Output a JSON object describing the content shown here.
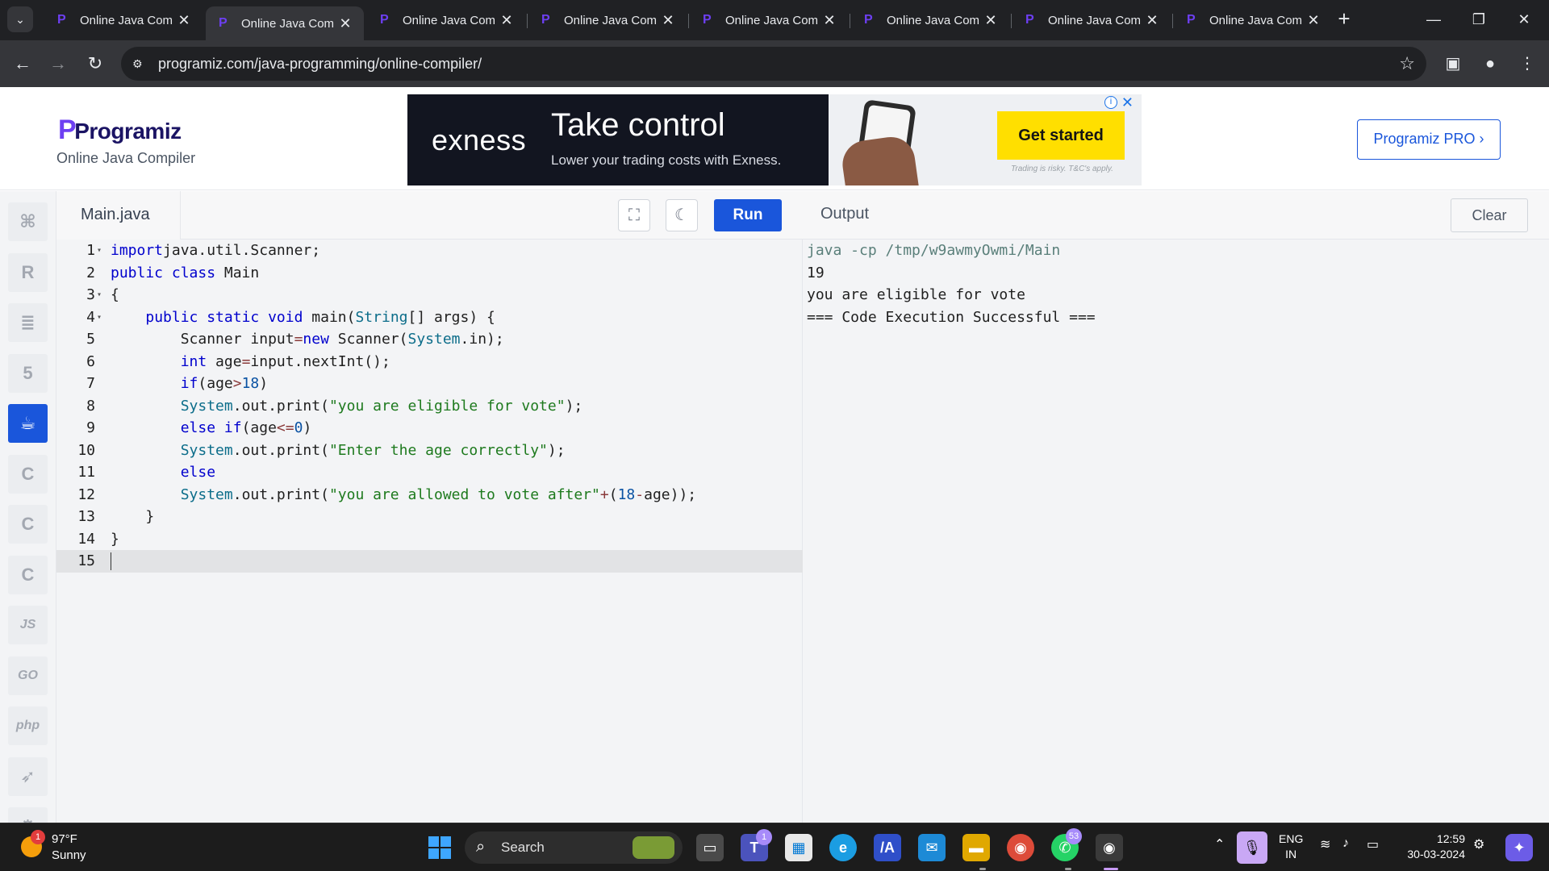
{
  "browser": {
    "tabs": [
      {
        "title": "Online Java Com",
        "active": false
      },
      {
        "title": "Online Java Com",
        "active": true
      },
      {
        "title": "Online Java Com",
        "active": false
      },
      {
        "title": "Online Java Com",
        "active": false
      },
      {
        "title": "Online Java Com",
        "active": false
      },
      {
        "title": "Online Java Com",
        "active": false
      },
      {
        "title": "Online Java Com",
        "active": false
      },
      {
        "title": "Online Java Com",
        "active": false
      }
    ],
    "url": "programiz.com/java-programming/online-compiler/"
  },
  "header": {
    "logo": "Programiz",
    "subtitle": "Online Java Compiler",
    "pro_button": "Programiz PRO ›"
  },
  "ad": {
    "brand": "exness",
    "headline": "Take control",
    "tagline": "Lower your trading costs with Exness.",
    "cta": "Get started",
    "disclaimer": "Trading is risky. T&C's apply."
  },
  "sidebar": {
    "languages": [
      {
        "name": "python-icon",
        "label": ""
      },
      {
        "name": "r-icon",
        "label": ""
      },
      {
        "name": "sql-icon",
        "label": ""
      },
      {
        "name": "html-icon",
        "label": ""
      },
      {
        "name": "java-icon",
        "label": "",
        "active": true
      },
      {
        "name": "c-icon",
        "label": ""
      },
      {
        "name": "cpp-icon",
        "label": ""
      },
      {
        "name": "csharp-icon",
        "label": ""
      },
      {
        "name": "js-icon",
        "label": "JS"
      },
      {
        "name": "go-icon",
        "label": "GO"
      },
      {
        "name": "php-icon",
        "label": "php"
      },
      {
        "name": "swift-icon",
        "label": ""
      },
      {
        "name": "rust-icon",
        "label": ""
      }
    ]
  },
  "editor": {
    "file_name": "Main.java",
    "run_label": "Run",
    "current_line": 15,
    "lines": [
      [
        [
          "kw",
          "import"
        ],
        [
          "",
          "java.util.Scanner;"
        ]
      ],
      [
        [
          "kw",
          "public class"
        ],
        [
          "",
          " Main"
        ]
      ],
      [
        [
          "",
          "{"
        ]
      ],
      [
        [
          "",
          "    "
        ],
        [
          "kw",
          "public static void"
        ],
        [
          "",
          " main("
        ],
        [
          "cls",
          "String"
        ],
        [
          "",
          "[] args) {"
        ]
      ],
      [
        [
          "",
          "        Scanner input"
        ],
        [
          "op",
          "="
        ],
        [
          "kw",
          "new"
        ],
        [
          "",
          " Scanner("
        ],
        [
          "cls",
          "System"
        ],
        [
          "",
          ".in);"
        ]
      ],
      [
        [
          "",
          "        "
        ],
        [
          "kw",
          "int"
        ],
        [
          "",
          " age"
        ],
        [
          "op",
          "="
        ],
        [
          "",
          "input.nextInt();"
        ]
      ],
      [
        [
          "",
          "        "
        ],
        [
          "kw",
          "if"
        ],
        [
          "",
          "(age"
        ],
        [
          "op",
          ">"
        ],
        [
          "num",
          "18"
        ],
        [
          "",
          ")"
        ]
      ],
      [
        [
          "",
          "        "
        ],
        [
          "cls",
          "System"
        ],
        [
          "",
          ".out.print("
        ],
        [
          "str",
          "\"you are eligible for vote\""
        ],
        [
          "",
          ");"
        ]
      ],
      [
        [
          "",
          "        "
        ],
        [
          "kw",
          "else if"
        ],
        [
          "",
          "(age"
        ],
        [
          "op",
          "<="
        ],
        [
          "num",
          "0"
        ],
        [
          "",
          ")"
        ]
      ],
      [
        [
          "",
          "        "
        ],
        [
          "cls",
          "System"
        ],
        [
          "",
          ".out.print("
        ],
        [
          "str",
          "\"Enter the age correctly\""
        ],
        [
          "",
          ");"
        ]
      ],
      [
        [
          "",
          "        "
        ],
        [
          "kw",
          "else"
        ]
      ],
      [
        [
          "",
          "        "
        ],
        [
          "cls",
          "System"
        ],
        [
          "",
          ".out.print("
        ],
        [
          "str",
          "\"you are allowed to vote after\""
        ],
        [
          "op",
          "+"
        ],
        [
          "",
          "("
        ],
        [
          "num",
          "18"
        ],
        [
          "op",
          "-"
        ],
        [
          "",
          "age));"
        ]
      ],
      [
        [
          "",
          "    }"
        ]
      ],
      [
        [
          "",
          "}"
        ]
      ],
      [
        [
          "",
          ""
        ]
      ]
    ],
    "fold_lines": [
      1,
      3,
      4
    ]
  },
  "output": {
    "title": "Output",
    "clear_label": "Clear",
    "lines": [
      {
        "text": "java -cp /tmp/w9awmyOwmi/Main",
        "kind": "cmd"
      },
      {
        "text": "19",
        "kind": "out"
      },
      {
        "text": "you are eligible for vote",
        "kind": "out"
      },
      {
        "text": "=== Code Execution Successful ===",
        "kind": "out"
      }
    ]
  },
  "taskbar": {
    "weather_badge": "1",
    "weather_temp": "97°F",
    "weather_desc": "Sunny",
    "search_label": "Search",
    "teams_badge": "1",
    "whatsapp_badge": "53",
    "lang": "ENG",
    "region": "IN",
    "time": "12:59",
    "date": "30-03-2024"
  }
}
